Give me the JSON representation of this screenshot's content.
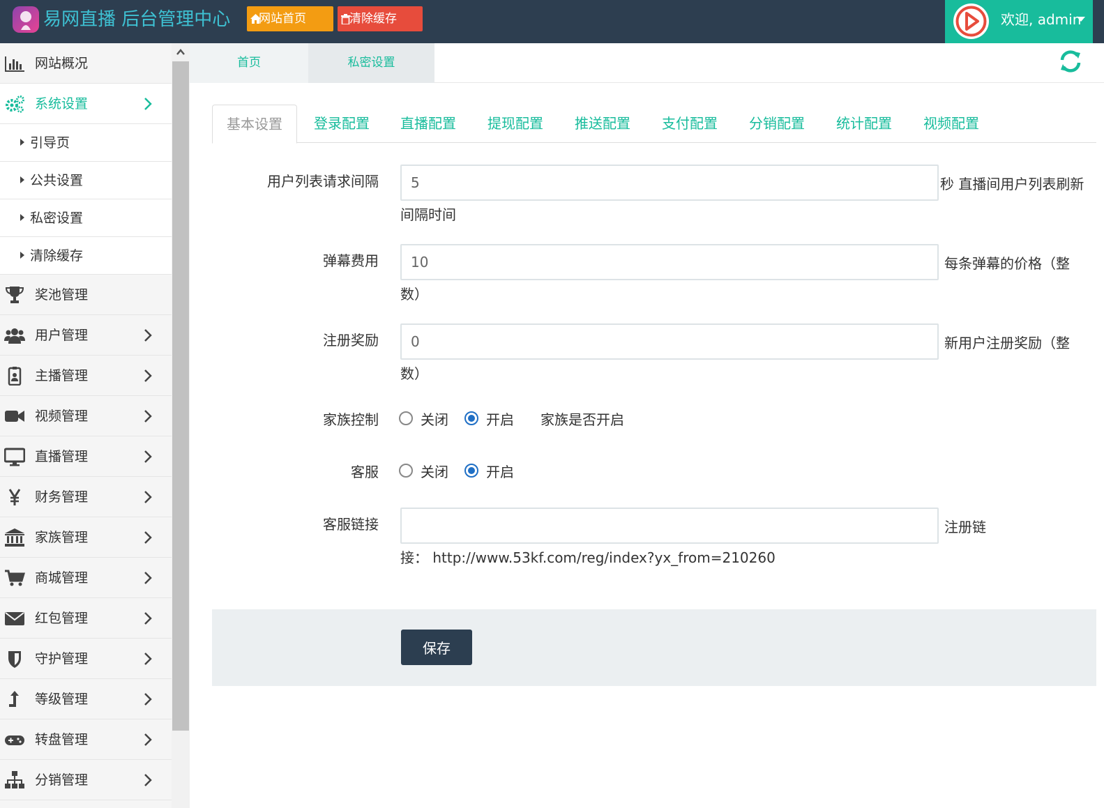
{
  "header": {
    "app_title": "易网直播 后台管理中心",
    "home_button": "网站首页",
    "clear_cache_button": "清除缓存",
    "welcome": "欢迎, admin",
    "colors": {
      "header_bg": "#2d3e50",
      "accent": "#18bc9c",
      "home_btn": "#f39c12",
      "clear_btn": "#e74c3c"
    }
  },
  "sidebar": {
    "items": [
      {
        "label": "网站概况",
        "icon": "bar-chart-icon"
      },
      {
        "label": "系统设置",
        "icon": "cogs-icon",
        "active": true
      },
      {
        "label": "奖池管理",
        "icon": "trophy-icon"
      },
      {
        "label": "用户管理",
        "icon": "users-icon"
      },
      {
        "label": "主播管理",
        "icon": "id-badge-icon"
      },
      {
        "label": "视频管理",
        "icon": "video-camera-icon"
      },
      {
        "label": "直播管理",
        "icon": "desktop-icon"
      },
      {
        "label": "财务管理",
        "icon": "yen-icon"
      },
      {
        "label": "家族管理",
        "icon": "bank-icon"
      },
      {
        "label": "商城管理",
        "icon": "cart-icon"
      },
      {
        "label": "红包管理",
        "icon": "envelope-icon"
      },
      {
        "label": "守护管理",
        "icon": "shield-icon"
      },
      {
        "label": "等级管理",
        "icon": "level-up-icon"
      },
      {
        "label": "转盘管理",
        "icon": "gamepad-icon"
      },
      {
        "label": "分销管理",
        "icon": "sitemap-icon"
      }
    ],
    "submenu": [
      "引导页",
      "公共设置",
      "私密设置",
      "清除缓存"
    ]
  },
  "page_tabs": {
    "home": "首页",
    "current": "私密设置",
    "close": "×"
  },
  "form_tabs": [
    "基本设置",
    "登录配置",
    "直播配置",
    "提现配置",
    "推送配置",
    "支付配置",
    "分销配置",
    "统计配置",
    "视频配置"
  ],
  "form": {
    "user_list_interval": {
      "label": "用户列表请求间隔",
      "value": "5",
      "help_1": "秒 直播间用户列表刷新",
      "help_2": "间隔时间"
    },
    "danmaku_fee": {
      "label": "弹幕费用",
      "value": "10",
      "help_1": "每条弹幕的价格（整",
      "help_2": "数）"
    },
    "register_reward": {
      "label": "注册奖励",
      "value": "0",
      "help_1": "新用户注册奖励（整",
      "help_2": "数）"
    },
    "family_control": {
      "label": "家族控制",
      "off": "关闭",
      "on": "开启",
      "selected": "开启",
      "help": "家族是否开启"
    },
    "customer_service": {
      "label": "客服",
      "off": "关闭",
      "on": "开启",
      "selected": "开启"
    },
    "service_link": {
      "label": "客服链接",
      "value": "",
      "help_1": "注册链",
      "help_2": "接：  http://www.53kf.com/reg/index?yx_from=210260"
    },
    "save_button": "保存"
  }
}
